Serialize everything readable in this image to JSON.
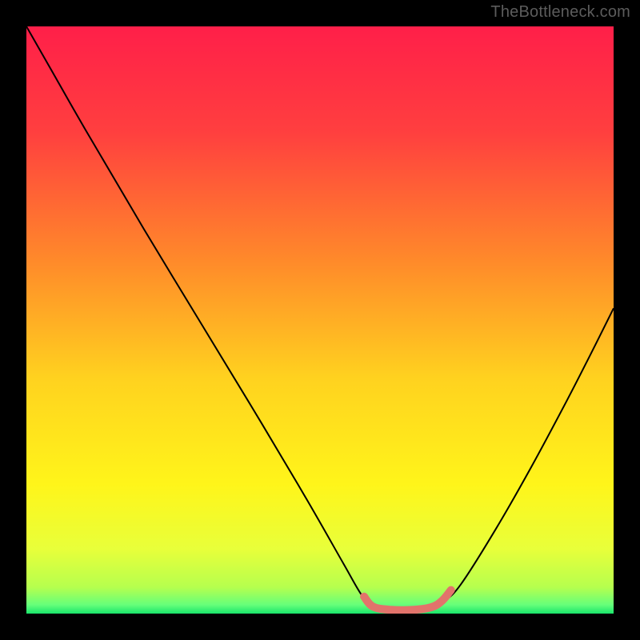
{
  "watermark": "TheBottleneck.com",
  "chart_data": {
    "type": "line",
    "title": "",
    "xlabel": "",
    "ylabel": "",
    "xlim": [
      0,
      100
    ],
    "ylim": [
      0,
      100
    ],
    "gradient_stops": [
      {
        "offset": 0.0,
        "color": "#ff1f49"
      },
      {
        "offset": 0.18,
        "color": "#ff3f3f"
      },
      {
        "offset": 0.4,
        "color": "#ff8a2a"
      },
      {
        "offset": 0.6,
        "color": "#ffd21f"
      },
      {
        "offset": 0.78,
        "color": "#fff51a"
      },
      {
        "offset": 0.89,
        "color": "#e8ff3a"
      },
      {
        "offset": 0.955,
        "color": "#b6ff4e"
      },
      {
        "offset": 0.985,
        "color": "#66ff7a"
      },
      {
        "offset": 1.0,
        "color": "#19e56b"
      }
    ],
    "series": [
      {
        "name": "bottleneck-curve",
        "color": "#000000",
        "width": 2,
        "points": [
          {
            "x": 0.0,
            "y": 100.0
          },
          {
            "x": 4.0,
            "y": 93.0
          },
          {
            "x": 10.0,
            "y": 82.5
          },
          {
            "x": 20.0,
            "y": 65.5
          },
          {
            "x": 30.0,
            "y": 49.0
          },
          {
            "x": 40.0,
            "y": 32.5
          },
          {
            "x": 48.0,
            "y": 19.0
          },
          {
            "x": 54.0,
            "y": 8.5
          },
          {
            "x": 57.0,
            "y": 3.3
          },
          {
            "x": 59.0,
            "y": 1.0
          },
          {
            "x": 62.0,
            "y": 0.4
          },
          {
            "x": 66.0,
            "y": 0.4
          },
          {
            "x": 69.0,
            "y": 0.9
          },
          {
            "x": 71.0,
            "y": 2.0
          },
          {
            "x": 74.0,
            "y": 5.0
          },
          {
            "x": 80.0,
            "y": 14.5
          },
          {
            "x": 86.0,
            "y": 25.0
          },
          {
            "x": 92.0,
            "y": 36.2
          },
          {
            "x": 96.0,
            "y": 44.0
          },
          {
            "x": 100.0,
            "y": 52.0
          }
        ]
      },
      {
        "name": "optimal-range-marker",
        "color": "#e2736b",
        "width": 10,
        "linecap": "round",
        "points": [
          {
            "x": 57.5,
            "y": 2.9
          },
          {
            "x": 59.0,
            "y": 1.2
          },
          {
            "x": 62.0,
            "y": 0.65
          },
          {
            "x": 66.0,
            "y": 0.65
          },
          {
            "x": 69.0,
            "y": 1.1
          },
          {
            "x": 70.8,
            "y": 2.2
          },
          {
            "x": 72.3,
            "y": 4.0
          }
        ]
      }
    ]
  }
}
